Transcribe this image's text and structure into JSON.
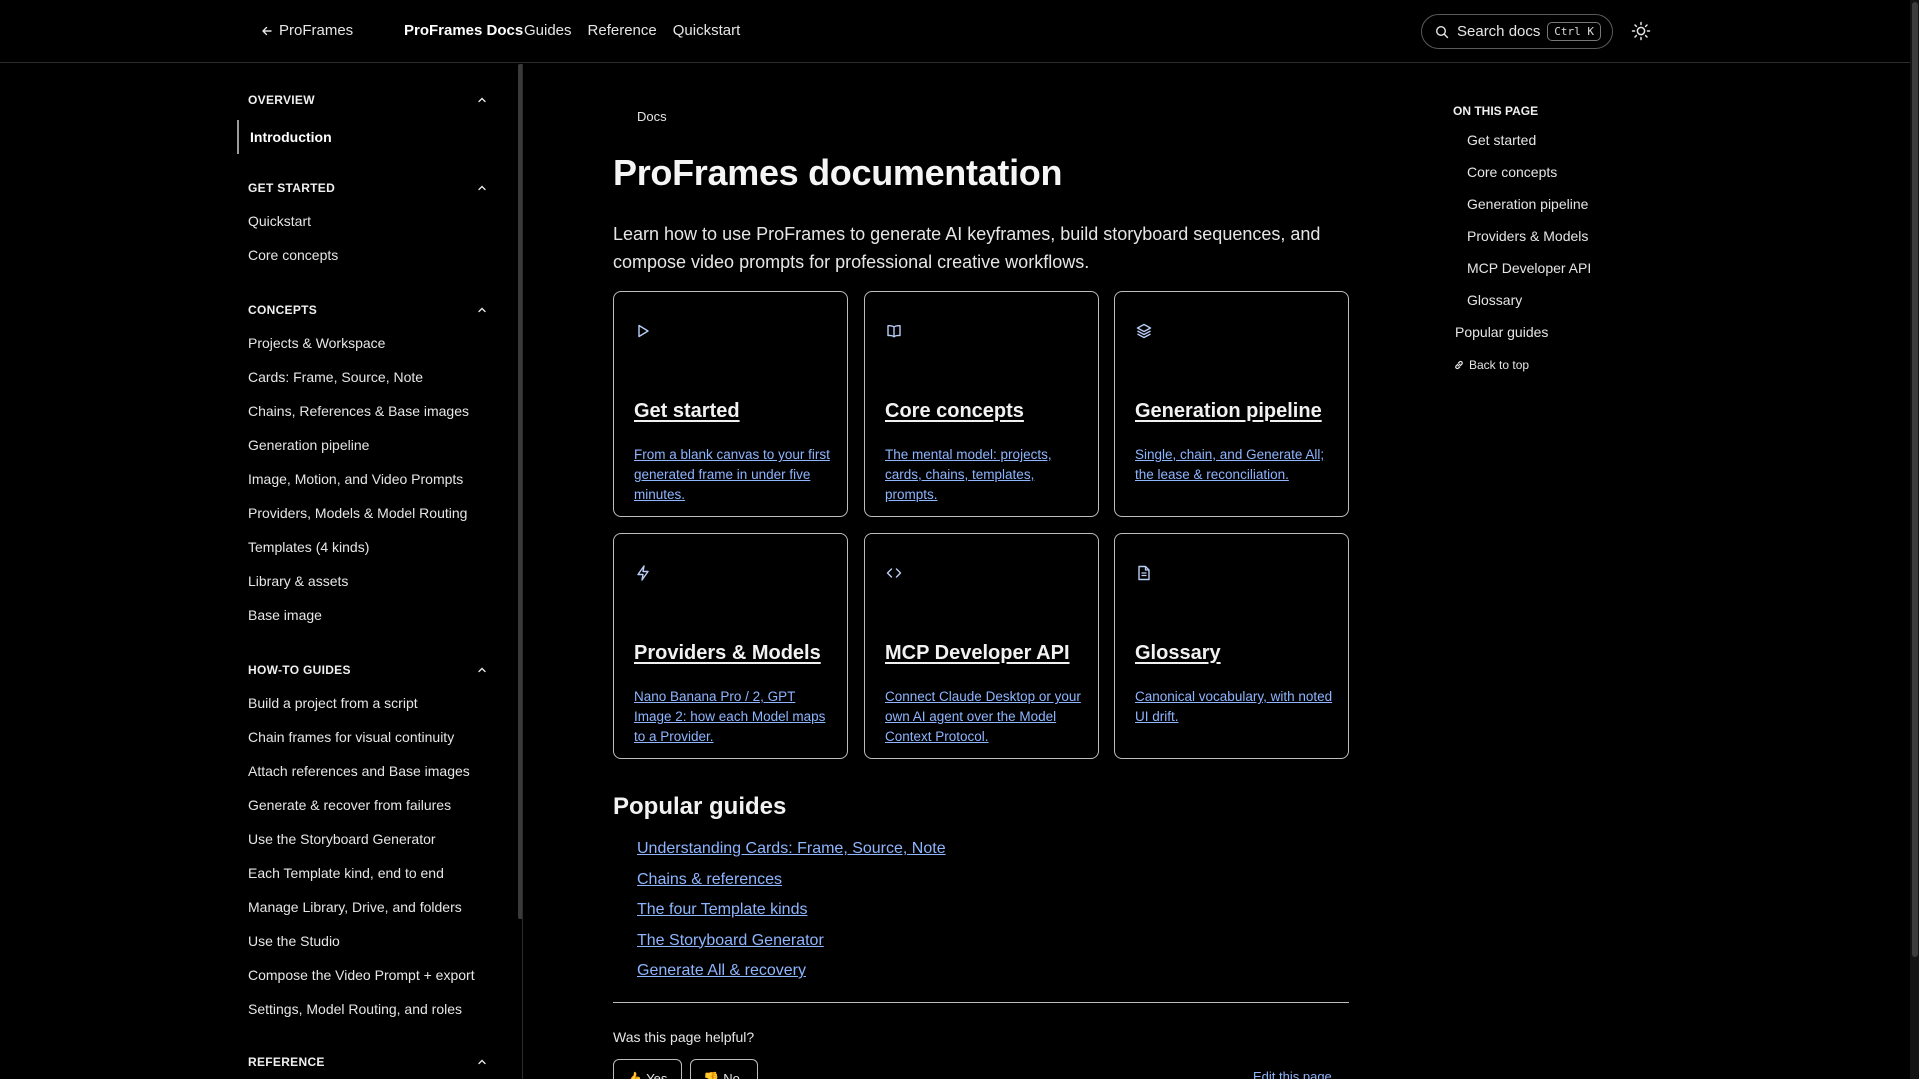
{
  "header": {
    "back_label": "ProFrames",
    "brand": "ProFrames Docs",
    "nav": [
      "Guides",
      "Reference",
      "Quickstart"
    ],
    "search_label": "Search docs",
    "search_shortcut": "Ctrl K",
    "theme_icon": "sun-icon"
  },
  "sidebar": {
    "overview": {
      "heading": "OVERVIEW",
      "active_item": "Introduction"
    },
    "get_started": {
      "heading": "GET STARTED",
      "items": [
        "Quickstart",
        "Core concepts"
      ]
    },
    "concepts": {
      "heading": "CONCEPTS",
      "items": [
        "Projects & Workspace",
        "Cards: Frame, Source, Note",
        "Chains, References & Base images",
        "Generation pipeline",
        "Image, Motion, and Video Prompts",
        "Providers, Models & Model Routing",
        "Templates (4 kinds)",
        "Library & assets",
        "Base image"
      ]
    },
    "howto": {
      "heading": "HOW-TO GUIDES",
      "items": [
        "Build a project from a script",
        "Chain frames for visual continuity",
        "Attach references and Base images",
        "Generate & recover from failures",
        "Use the Storyboard Generator",
        "Each Template kind, end to end",
        "Manage Library, Drive, and folders",
        "Use the Studio",
        "Compose the Video Prompt + export",
        "Settings, Model Routing, and roles"
      ]
    },
    "reference": {
      "heading": "REFERENCE"
    }
  },
  "main": {
    "breadcrumb": "Docs",
    "title": "ProFrames documentation",
    "lead": "Learn how to use ProFrames to generate AI keyframes, build storyboard sequences, and compose video prompts for professional creative workflows.",
    "cards": [
      {
        "icon": "play-icon",
        "title": "Get started",
        "desc": "From a blank canvas to your first generated frame in under five minutes."
      },
      {
        "icon": "book-icon",
        "title": "Core concepts",
        "desc": "The mental model: projects, cards, chains, templates, prompts."
      },
      {
        "icon": "layers-icon",
        "title": "Generation pipeline",
        "desc": "Single, chain, and Generate All; the lease & reconciliation."
      },
      {
        "icon": "zap-icon",
        "title": "Providers & Models",
        "desc": "Nano Banana Pro / 2, GPT Image 2: how each Model maps to a Provider."
      },
      {
        "icon": "code-icon",
        "title": "MCP Developer API",
        "desc": "Connect Claude Desktop or your own AI agent over the Model Context Protocol."
      },
      {
        "icon": "file-text-icon",
        "title": "Glossary",
        "desc": "Canonical vocabulary, with noted UI drift."
      }
    ],
    "popular_title": "Popular guides",
    "popular": [
      "Understanding Cards: Frame, Source, Note",
      "Chains & references",
      "The four Template kinds",
      "The Storyboard Generator",
      "Generate All & recovery"
    ],
    "helpful_question": "Was this page helpful?",
    "yes_label": "Yes",
    "no_label": "No",
    "edit_label": "Edit this page"
  },
  "toc": {
    "title": "ON THIS PAGE",
    "items": [
      "Get started",
      "Core concepts",
      "Generation pipeline",
      "Providers & Models",
      "MCP Developer API",
      "Glossary"
    ],
    "popular": "Popular guides",
    "back_to_top": "Back to top"
  },
  "colors": {
    "background": "#000000",
    "link": "#8eb5ff",
    "border": "#bdbdbd"
  }
}
